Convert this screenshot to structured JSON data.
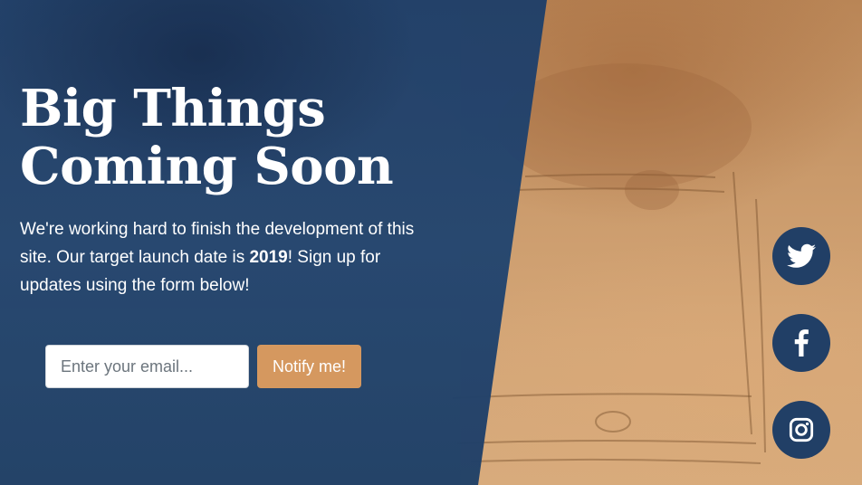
{
  "hero": {
    "headline_line1": "Big Things",
    "headline_line2": "Coming Soon",
    "desc_part1": "We're working hard to finish the development of this site. Our target launch date is ",
    "desc_bold": "2019",
    "desc_part2": "! Sign up for updates using the form below!"
  },
  "form": {
    "email_placeholder": "Enter your email...",
    "email_value": "",
    "submit_label": "Notify me!"
  },
  "social": {
    "items": [
      {
        "icon": "twitter-icon"
      },
      {
        "icon": "facebook-icon"
      },
      {
        "icon": "instagram-icon"
      }
    ]
  },
  "colors": {
    "panel": "#234670",
    "accent_button": "#d5985f",
    "social_circle": "#213f66",
    "text": "#ffffff"
  }
}
